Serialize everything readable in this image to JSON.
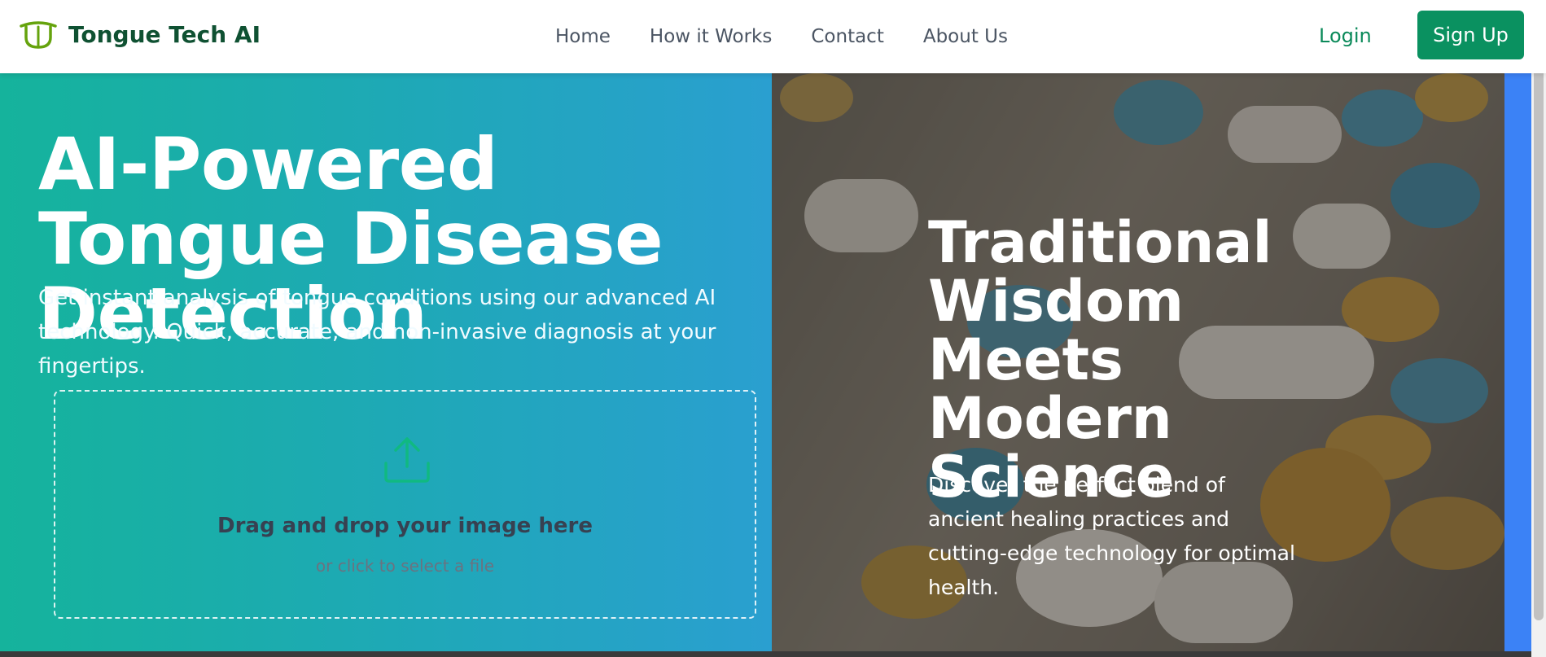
{
  "brand": {
    "name": "Tongue Tech AI",
    "icon": "tongue-logo-icon"
  },
  "nav": {
    "links": [
      "Home",
      "How it Works",
      "Contact",
      "About Us"
    ],
    "login_label": "Login",
    "signup_label": "Sign Up"
  },
  "hero": {
    "title": "AI-Powered Tongue Disease Detection",
    "subtitle": "Get instant analysis of tongue conditions using our advanced AI technology. Quick, accurate, and non-invasive diagnosis at your fingertips.",
    "upload": {
      "icon": "upload-icon",
      "main_text": "Drag and drop your image here",
      "sub_text": "or click to select a file"
    }
  },
  "feature": {
    "title": "Traditional Wisdom Meets Modern Science",
    "subtitle": "Discover the perfect blend of ancient healing practices and cutting-edge technology for optimal health."
  },
  "colors": {
    "brand_green": "#0a9160",
    "hero_gradient_start": "#15b39c",
    "hero_gradient_end": "#2a9fd0",
    "accent_blue": "#3b82f6"
  }
}
